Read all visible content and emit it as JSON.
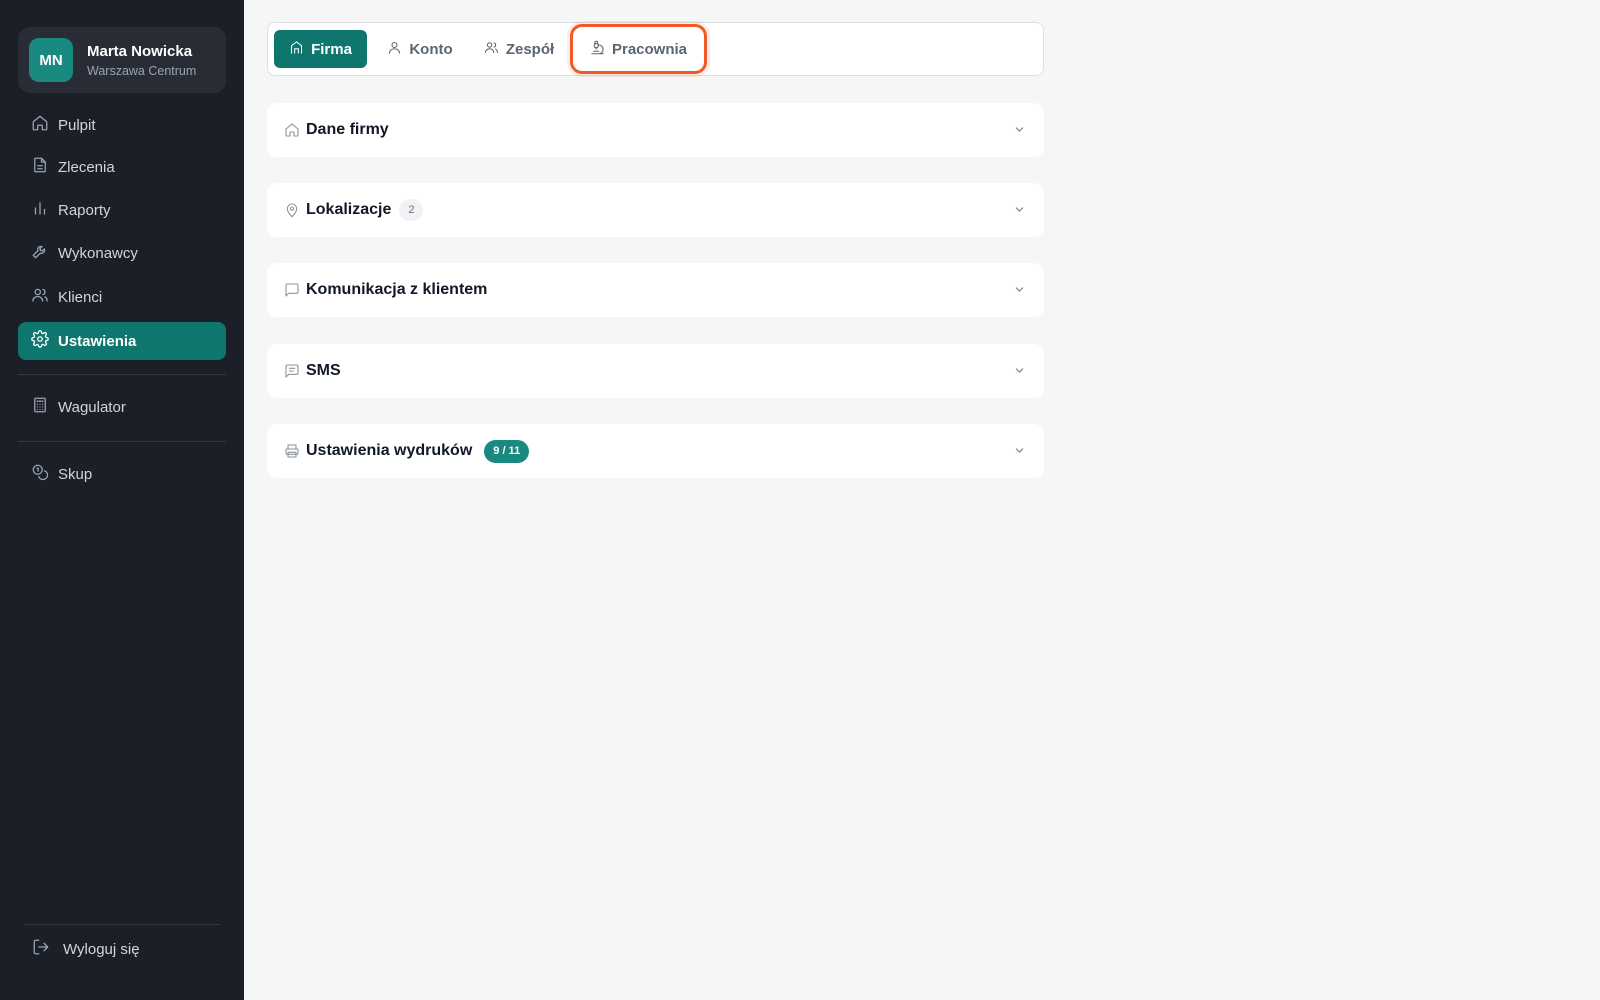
{
  "user": {
    "initials": "MN",
    "name": "Marta Nowicka",
    "location": "Warszawa Centrum"
  },
  "sidebar": {
    "items": [
      {
        "label": "Pulpit",
        "icon": "home-icon"
      },
      {
        "label": "Zlecenia",
        "icon": "document-icon"
      },
      {
        "label": "Raporty",
        "icon": "bar-chart-icon"
      },
      {
        "label": "Wykonawcy",
        "icon": "wrench-icon"
      },
      {
        "label": "Klienci",
        "icon": "users-icon"
      },
      {
        "label": "Ustawienia",
        "icon": "gear-icon",
        "active": true
      },
      {
        "label": "Wagulator",
        "icon": "calculator-icon"
      },
      {
        "label": "Skup",
        "icon": "coins-icon"
      }
    ],
    "logout_label": "Wyloguj się"
  },
  "tabs": [
    {
      "label": "Firma",
      "icon": "building-icon",
      "active": true
    },
    {
      "label": "Konto",
      "icon": "user-icon"
    },
    {
      "label": "Zespół",
      "icon": "users-icon"
    },
    {
      "label": "Pracownia",
      "icon": "microscope-icon",
      "highlighted": true
    }
  ],
  "sections": [
    {
      "title": "Dane firmy",
      "icon": "home-icon"
    },
    {
      "title": "Lokalizacje",
      "icon": "map-pin-icon",
      "badge": "2"
    },
    {
      "title": "Komunikacja z klientem",
      "icon": "chat-bubble-icon"
    },
    {
      "title": "SMS",
      "icon": "message-icon"
    },
    {
      "title": "Ustawienia wydruków",
      "icon": "printer-icon",
      "badge": "9 / 11"
    }
  ],
  "colors": {
    "sidebar_bg": "#1b1f27",
    "accent": "#0f766e",
    "highlight_outline": "#f05a28",
    "page_bg": "#f5f6f6"
  }
}
